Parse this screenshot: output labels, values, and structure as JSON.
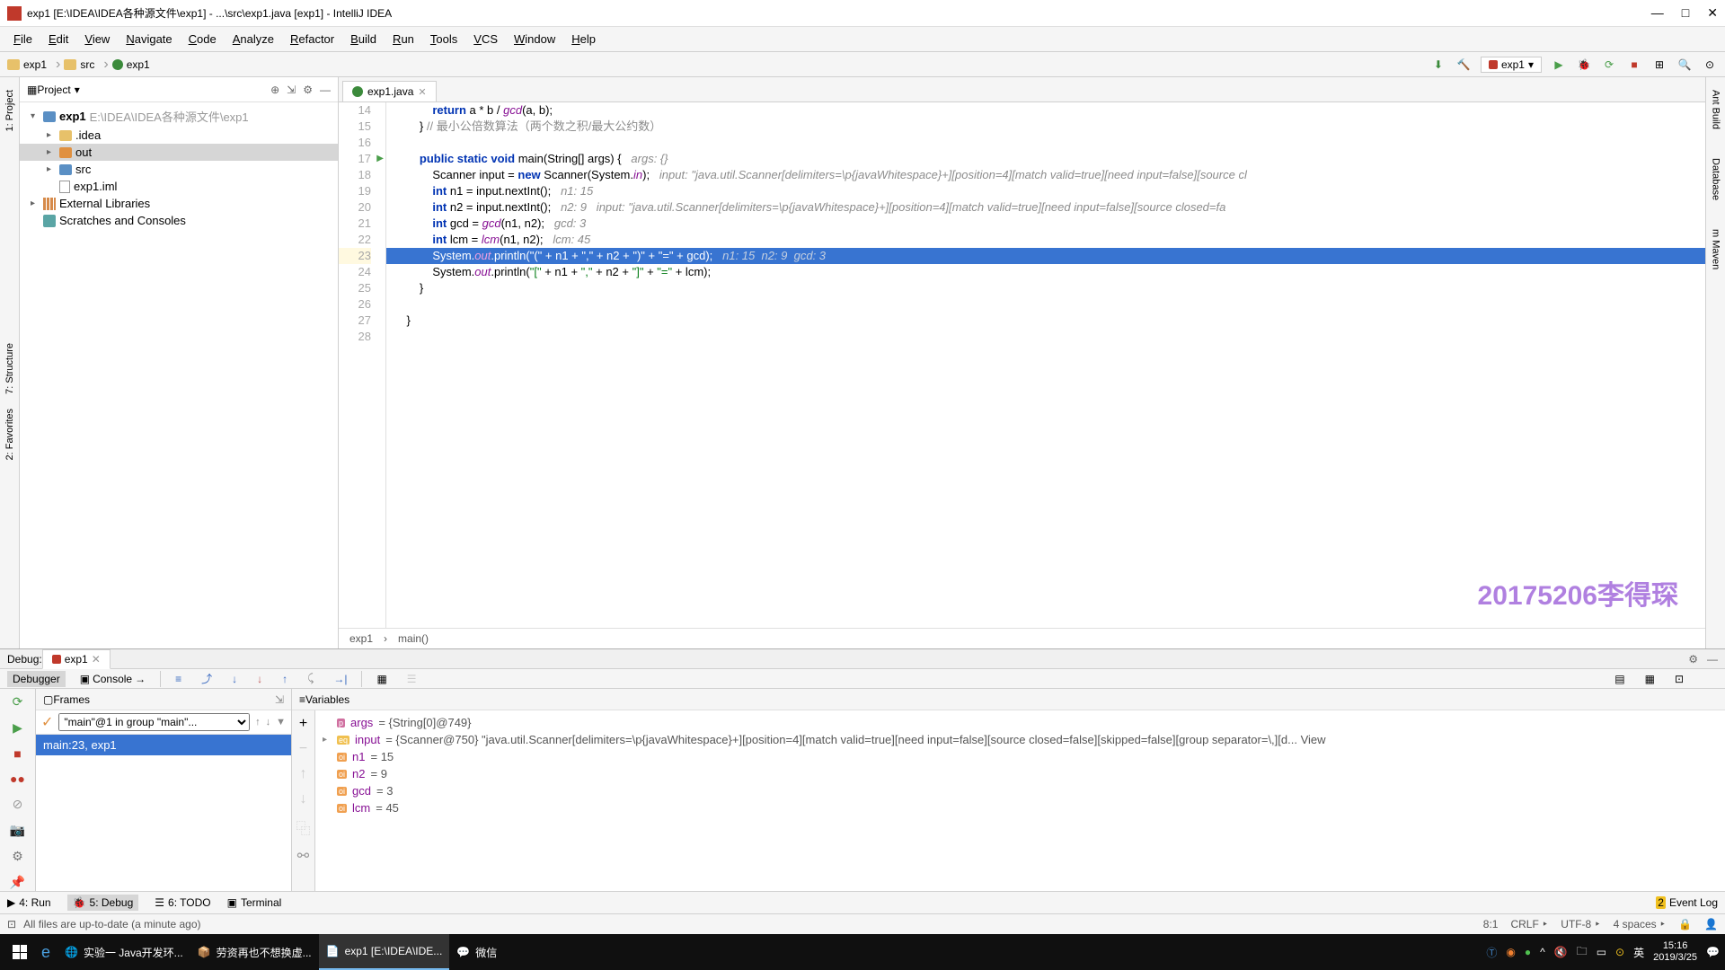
{
  "titlebar": {
    "title": "exp1 [E:\\IDEA\\IDEA各种源文件\\exp1] - ...\\src\\exp1.java [exp1] - IntelliJ IDEA"
  },
  "menu": [
    "File",
    "Edit",
    "View",
    "Navigate",
    "Code",
    "Analyze",
    "Refactor",
    "Build",
    "Run",
    "Tools",
    "VCS",
    "Window",
    "Help"
  ],
  "breadcrumbs": [
    {
      "icon": "folder",
      "label": "exp1"
    },
    {
      "icon": "folder",
      "label": "src"
    },
    {
      "icon": "class",
      "label": "exp1"
    }
  ],
  "runConfig": "exp1",
  "project": {
    "title": "Project",
    "tree": [
      {
        "indent": 0,
        "arrow": "v",
        "icon": "folder-blue",
        "label": "exp1",
        "suffix": "E:\\IDEA\\IDEA各种源文件\\exp1",
        "bold": true
      },
      {
        "indent": 1,
        "arrow": ">",
        "icon": "folder",
        "label": ".idea"
      },
      {
        "indent": 1,
        "arrow": ">",
        "icon": "folder-orange",
        "label": "out",
        "selected": true
      },
      {
        "indent": 1,
        "arrow": ">",
        "icon": "folder-blue",
        "label": "src"
      },
      {
        "indent": 1,
        "arrow": "",
        "icon": "file",
        "label": "exp1.iml"
      },
      {
        "indent": 0,
        "arrow": ">",
        "icon": "lib",
        "label": "External Libraries"
      },
      {
        "indent": 0,
        "arrow": "",
        "icon": "scratch",
        "label": "Scratches and Consoles"
      }
    ]
  },
  "editor": {
    "tab": "exp1.java",
    "startLine": 14,
    "highlightLine": 23,
    "lines": [
      {
        "n": 14,
        "html": "            <span class='kw'>return</span> a * b / <span class='field'>gcd</span>(a, b);"
      },
      {
        "n": 15,
        "html": "        } <span class='comment'>// 最小公倍数算法（两个数之积/最大公约数）</span>"
      },
      {
        "n": 16,
        "html": ""
      },
      {
        "n": 17,
        "html": "        <span class='kw'>public static void</span> main(String[] args) {   <span class='hint'>args: {}</span>",
        "play": true
      },
      {
        "n": 18,
        "html": "            Scanner input = <span class='kw'>new</span> Scanner(System.<span class='field'>in</span>);   <span class='hint'>input: \"java.util.Scanner[delimiters=\\p{javaWhitespace}+][position=4][match valid=true][need input=false][source cl</span>"
      },
      {
        "n": 19,
        "html": "            <span class='kw'>int</span> n1 = input.nextInt();   <span class='hint'>n1: 15</span>"
      },
      {
        "n": 20,
        "html": "            <span class='kw'>int</span> n2 = input.nextInt();   <span class='hint'>n2: 9   input: \"java.util.Scanner[delimiters=\\p{javaWhitespace}+][position=4][match valid=true][need input=false][source closed=fa</span>"
      },
      {
        "n": 21,
        "html": "            <span class='kw'>int</span> gcd = <span class='field'>gcd</span>(n1, n2);   <span class='hint'>gcd: 3</span>"
      },
      {
        "n": 22,
        "html": "            <span class='kw'>int</span> lcm = <span class='field'>lcm</span>(n1, n2);   <span class='hint'>lcm: 45</span>"
      },
      {
        "n": 23,
        "html": "            System.<span class='field'>out</span>.println(<span class='str'>\"(\"</span> + n1 + <span class='str'>\",\"</span> + n2 + <span class='str'>\")\"</span> + <span class='str'>\"=\"</span> + gcd);   <span class='cmm'>n1: 15  n2: 9  gcd: 3</span>",
        "hl": true
      },
      {
        "n": 24,
        "html": "            System.<span class='field'>out</span>.println(<span class='str'>\"[\"</span> + n1 + <span class='str'>\",\"</span> + n2 + <span class='str'>\"]\"</span> + <span class='str'>\"=\"</span> + lcm);"
      },
      {
        "n": 25,
        "html": "        }"
      },
      {
        "n": 26,
        "html": ""
      },
      {
        "n": 27,
        "html": "    }"
      },
      {
        "n": 28,
        "html": ""
      }
    ],
    "breadcrumb": [
      "exp1",
      "main()"
    ],
    "watermark": "20175206李得琛"
  },
  "debug": {
    "title": "Debug:",
    "tab": "exp1",
    "subtabs": {
      "debugger": "Debugger",
      "console": "Console"
    },
    "frames": {
      "title": "Frames",
      "thread": "\"main\"@1 in group \"main\"...",
      "row": "main:23, exp1"
    },
    "variables": {
      "title": "Variables",
      "items": [
        {
          "badge": "p",
          "arrow": "",
          "name": "args",
          "val": " = {String[0]@749}"
        },
        {
          "badge": "eq",
          "arrow": ">",
          "name": "input",
          "val": " = {Scanner@750} \"java.util.Scanner[delimiters=\\p{javaWhitespace}+][position=4][match valid=true][need input=false][source closed=false][skipped=false][group separator=\\,][d... View"
        },
        {
          "badge": "oi",
          "arrow": "",
          "name": "n1",
          "val": " = 15"
        },
        {
          "badge": "oi",
          "arrow": "",
          "name": "n2",
          "val": " = 9"
        },
        {
          "badge": "oi",
          "arrow": "",
          "name": "gcd",
          "val": " = 3"
        },
        {
          "badge": "oi",
          "arrow": "",
          "name": "lcm",
          "val": " = 45"
        }
      ]
    }
  },
  "bottomTabs": {
    "run": "4: Run",
    "debug": "5: Debug",
    "todo": "6: TODO",
    "terminal": "Terminal",
    "eventLog": "Event Log"
  },
  "statusbar": {
    "msg": "All files are up-to-date (a minute ago)",
    "pos": "8:1",
    "crlf": "CRLF",
    "enc": "UTF-8",
    "indent": "4 spaces"
  },
  "taskbar": {
    "items": [
      {
        "label": "实验一 Java开发环..."
      },
      {
        "label": "劳资再也不想换虚..."
      },
      {
        "label": "exp1 [E:\\IDEA\\IDE...",
        "active": true
      },
      {
        "label": "微信"
      }
    ],
    "time": "15:16",
    "date": "2019/3/25",
    "ime": "英"
  }
}
